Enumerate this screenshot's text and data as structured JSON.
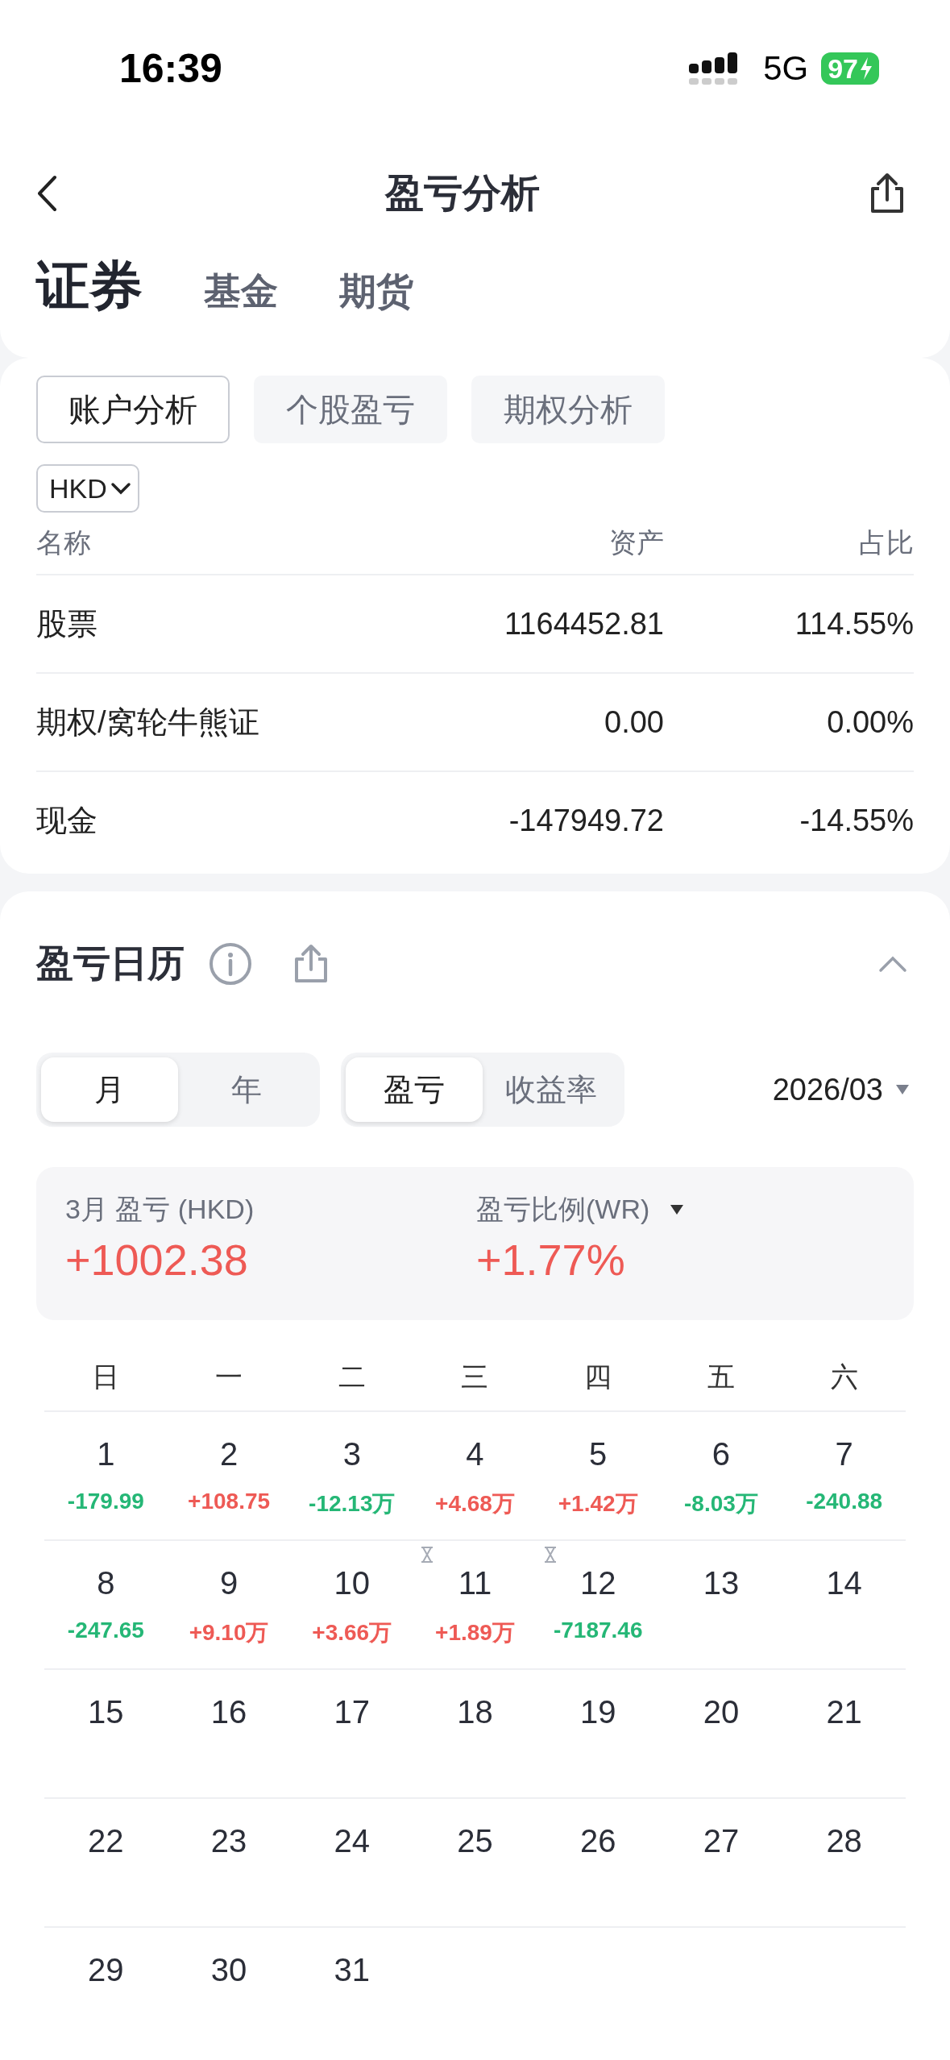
{
  "status_bar": {
    "time": "16:39",
    "network": "5G",
    "battery": "97"
  },
  "nav": {
    "title": "盈亏分析"
  },
  "asset_tabs": [
    {
      "label": "证券",
      "selected": true
    },
    {
      "label": "基金",
      "selected": false
    },
    {
      "label": "期货",
      "selected": false
    }
  ],
  "analysis_tabs": [
    {
      "label": "账户分析",
      "selected": true
    },
    {
      "label": "个股盈亏",
      "selected": false
    },
    {
      "label": "期权分析",
      "selected": false
    }
  ],
  "currency": "HKD",
  "table": {
    "columns": [
      "名称",
      "资产",
      "占比"
    ],
    "rows": [
      [
        "股票",
        "1164452.81",
        "114.55%"
      ],
      [
        "期权/窝轮牛熊证",
        "0.00",
        "0.00%"
      ],
      [
        "现金",
        "-147949.72",
        "-14.55%"
      ]
    ]
  },
  "calendar": {
    "title": "盈亏日历",
    "period_toggle": [
      {
        "label": "月",
        "selected": true
      },
      {
        "label": "年",
        "selected": false
      }
    ],
    "metric_toggle": [
      {
        "label": "盈亏",
        "selected": true
      },
      {
        "label": "收益率",
        "selected": false
      }
    ],
    "month": "2026/03",
    "summary": [
      {
        "label": "3月 盈亏 (HKD)",
        "value": "+1002.38",
        "dropdown": false
      },
      {
        "label": "盈亏比例(WR)",
        "value": "+1.77%",
        "dropdown": true
      }
    ],
    "weekdays": [
      "日",
      "一",
      "二",
      "三",
      "四",
      "五",
      "六"
    ],
    "days": [
      {
        "day": "1",
        "value": "-179.99",
        "color": "#25b776",
        "pending": false
      },
      {
        "day": "2",
        "value": "+108.75",
        "color": "#ee5a55",
        "pending": false
      },
      {
        "day": "3",
        "value": "-12.13万",
        "color": "#25b776",
        "pending": false
      },
      {
        "day": "4",
        "value": "+4.68万",
        "color": "#ee5a55",
        "pending": false
      },
      {
        "day": "5",
        "value": "+1.42万",
        "color": "#ee5a55",
        "pending": false
      },
      {
        "day": "6",
        "value": "-8.03万",
        "color": "#25b776",
        "pending": false
      },
      {
        "day": "7",
        "value": "-240.88",
        "color": "#25b776",
        "pending": false
      },
      {
        "day": "8",
        "value": "-247.65",
        "color": "#25b776",
        "pending": false
      },
      {
        "day": "9",
        "value": "+9.10万",
        "color": "#ee5a55",
        "pending": false
      },
      {
        "day": "10",
        "value": "+3.66万",
        "color": "#ee5a55",
        "pending": false
      },
      {
        "day": "11",
        "value": "+1.89万",
        "color": "#ee5a55",
        "pending": true
      },
      {
        "day": "12",
        "value": "-7187.46",
        "color": "#25b776",
        "pending": true
      },
      {
        "day": "13",
        "pending": false
      },
      {
        "day": "14",
        "pending": false
      },
      {
        "day": "15",
        "pending": false
      },
      {
        "day": "16",
        "pending": false
      },
      {
        "day": "17",
        "pending": false
      },
      {
        "day": "18",
        "pending": false
      },
      {
        "day": "19",
        "pending": false
      },
      {
        "day": "20",
        "pending": false
      },
      {
        "day": "21",
        "pending": false
      },
      {
        "day": "22",
        "pending": false
      },
      {
        "day": "23",
        "pending": false
      },
      {
        "day": "24",
        "pending": false
      },
      {
        "day": "25",
        "pending": false
      },
      {
        "day": "26",
        "pending": false
      },
      {
        "day": "27",
        "pending": false
      },
      {
        "day": "28",
        "pending": false
      },
      {
        "day": "29",
        "pending": false
      },
      {
        "day": "30",
        "pending": false
      },
      {
        "day": "31",
        "pending": false
      }
    ]
  }
}
